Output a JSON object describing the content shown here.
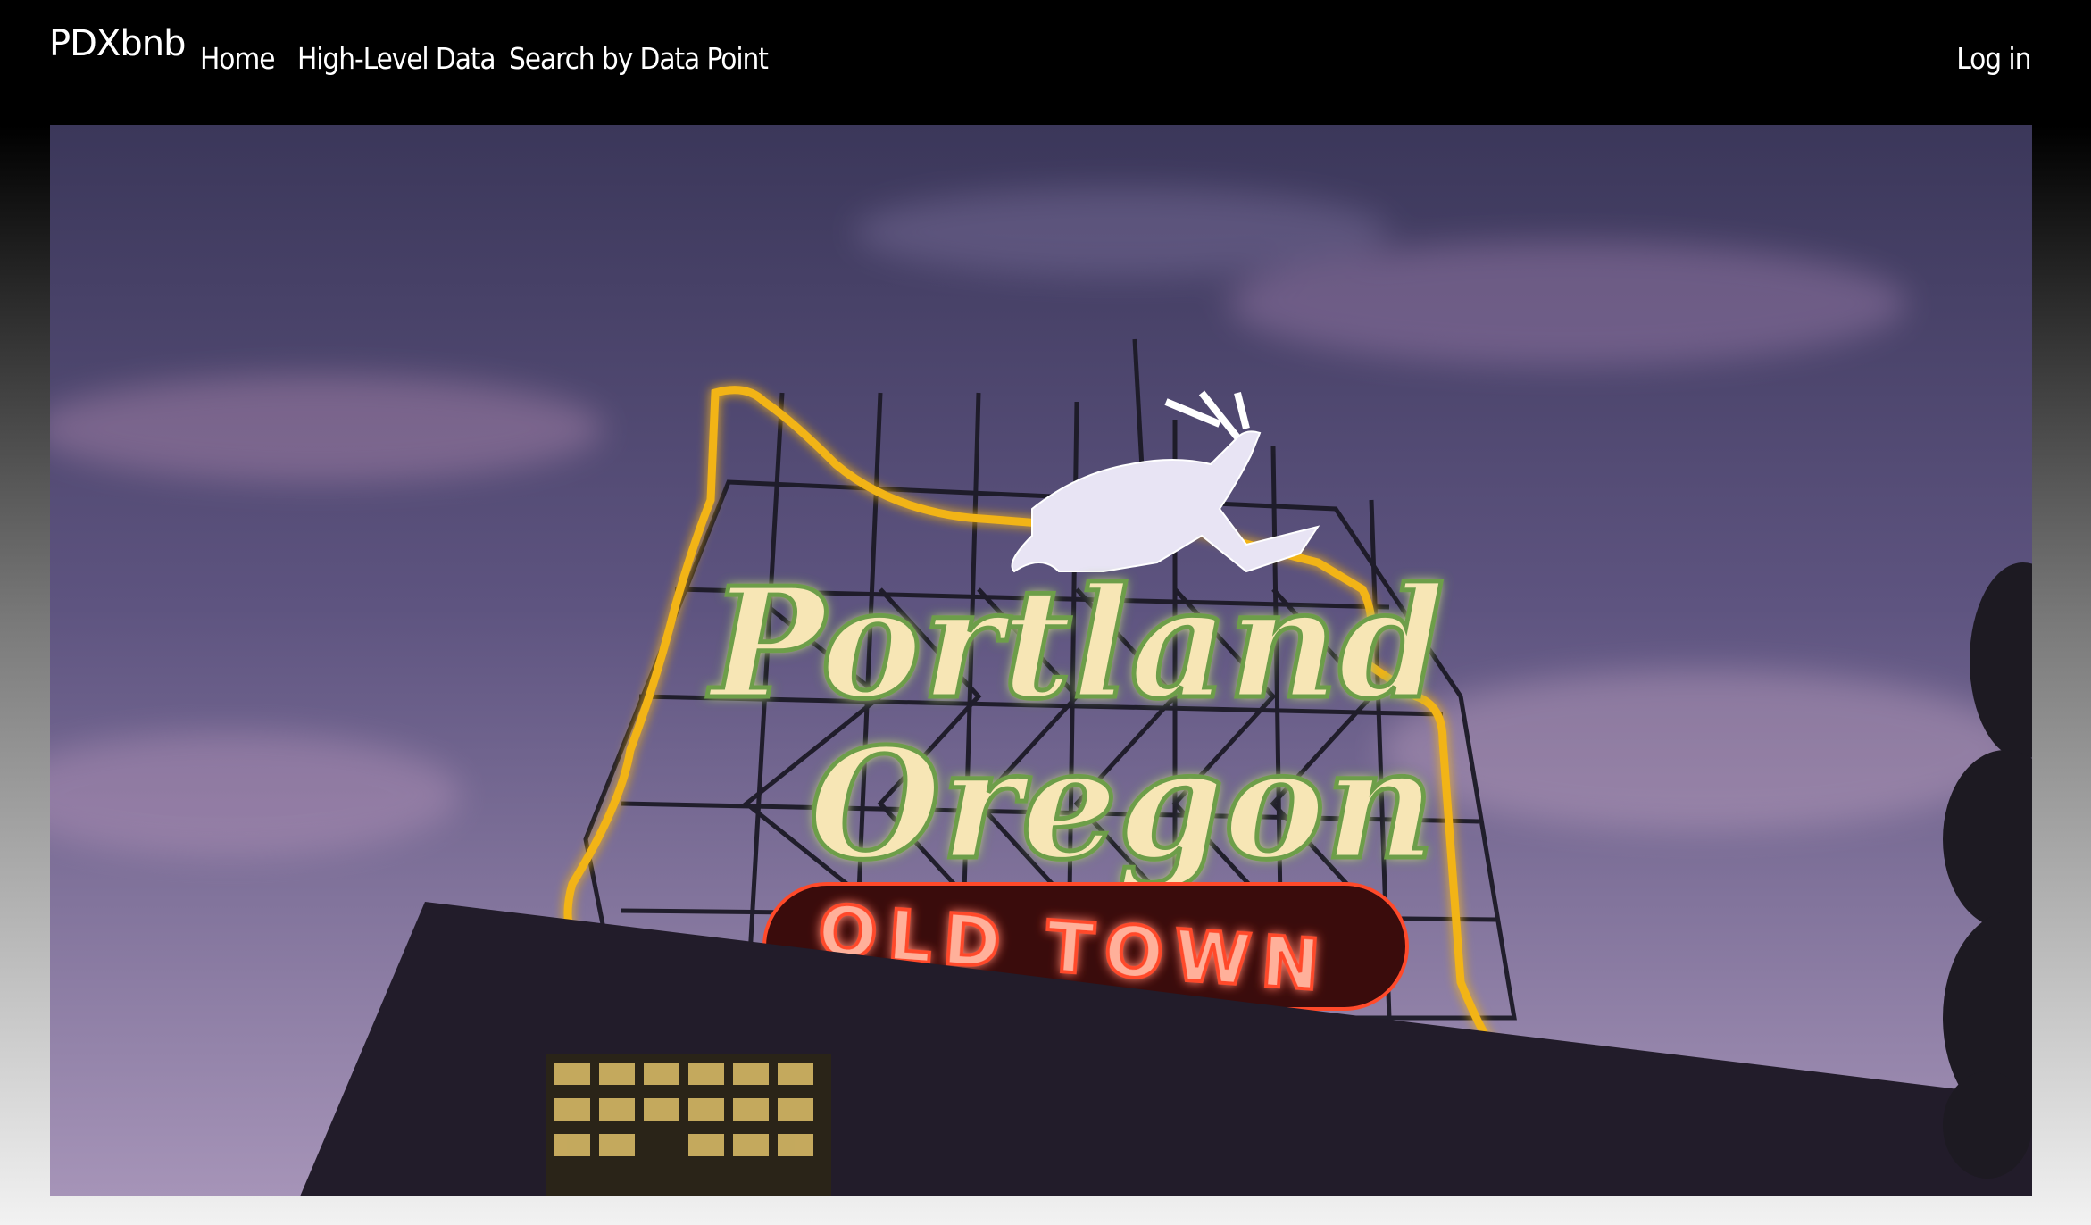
{
  "navbar": {
    "brand": "PDXbnb",
    "links": [
      {
        "label": "Home"
      },
      {
        "label": "High-Level Data"
      },
      {
        "label": "Search by Data Point"
      }
    ],
    "login_label": "Log in"
  },
  "hero": {
    "image_name": "portland-oregon-old-town-sign-photo",
    "sign_text": {
      "line1": "Portland",
      "line2": "Oregon",
      "line3": "OLD TOWN"
    }
  },
  "colors": {
    "navbar_bg": "#000000",
    "nav_text": "#ffffff",
    "sky_top": "#3f3b5c",
    "sky_bottom": "#9a8ab0",
    "sign_outline": "#f2b416",
    "sign_bulbs": "#f7e6b5",
    "neon_red": "#ff4a2a"
  }
}
